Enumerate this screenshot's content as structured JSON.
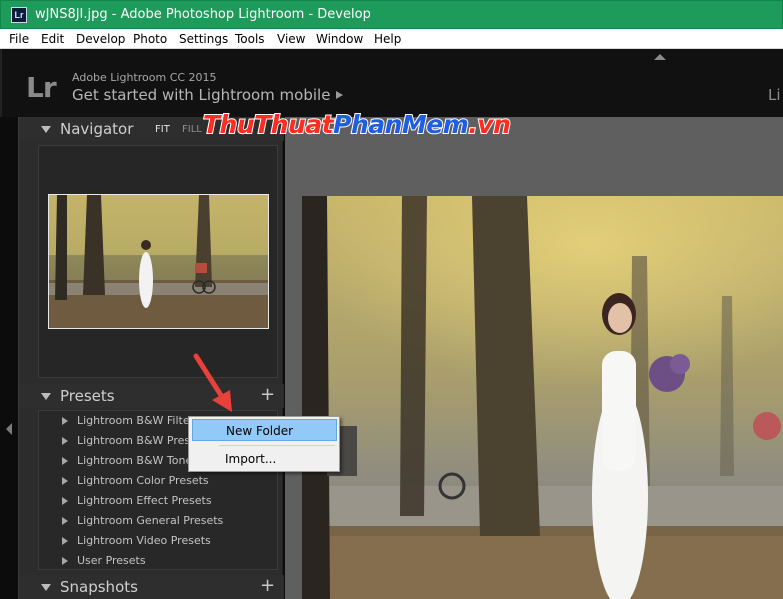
{
  "window": {
    "title": "wJNS8JI.jpg - Adobe Photoshop Lightroom - Develop",
    "app_icon_text": "Lr"
  },
  "menubar": {
    "items": [
      "File",
      "Edit",
      "Develop",
      "Photo",
      "Settings",
      "Tools",
      "View",
      "Window",
      "Help"
    ]
  },
  "lightroom": {
    "logo": "Lr",
    "version": "Adobe Lightroom CC 2015",
    "mobile_prompt": "Get started with Lightroom mobile",
    "module_partial": "Li"
  },
  "navigator": {
    "title": "Navigator",
    "options": [
      "FIT",
      "FILL"
    ]
  },
  "presets": {
    "title": "Presets",
    "add_label": "+",
    "items": [
      "Lightroom B&W Filter",
      "Lightroom B&W Prese",
      "Lightroom B&W Tone",
      "Lightroom Color Presets",
      "Lightroom Effect Presets",
      "Lightroom General Presets",
      "Lightroom Video Presets",
      "User Presets"
    ]
  },
  "snapshots": {
    "title": "Snapshots",
    "add_label": "+"
  },
  "context_menu": {
    "items": [
      "New Folder",
      "Import..."
    ],
    "highlighted": "New Folder"
  },
  "watermark": {
    "part1": "ThuThuat",
    "part2": "PhanMem",
    "part3": ".vn"
  },
  "colors": {
    "titlebar": "#1e9b5a",
    "menu_highlight": "#91c9f7",
    "annotation_arrow": "#e8403a"
  }
}
